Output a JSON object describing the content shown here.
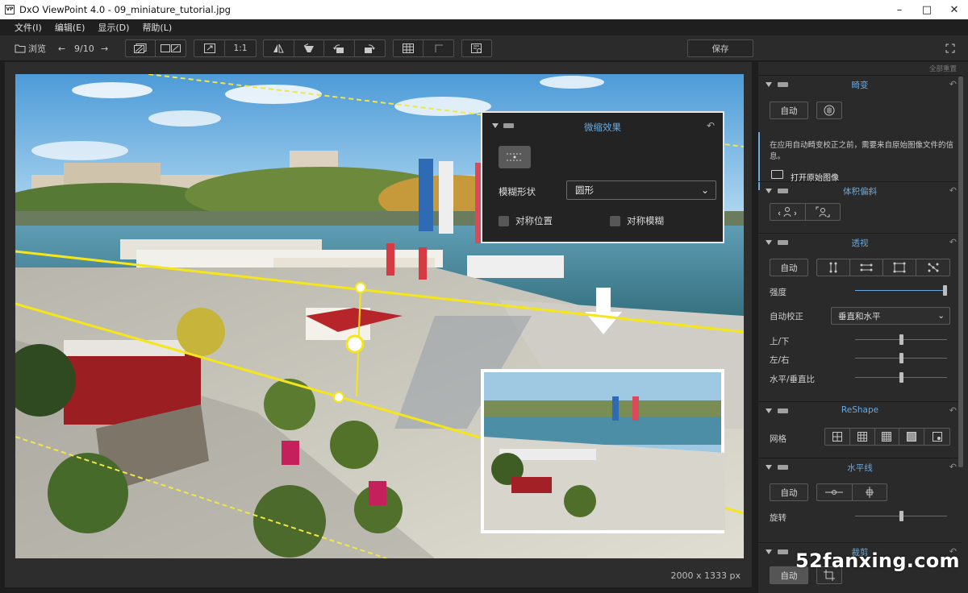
{
  "window": {
    "title": "DxO ViewPoint 4.0 - 09_miniature_tutorial.jpg",
    "app_icon_text": "VP"
  },
  "menu": [
    "文件(I)",
    "编辑(E)",
    "显示(D)",
    "帮助(L)"
  ],
  "toolbar": {
    "browse_label": "浏览",
    "page_counter": "9/10",
    "one_to_one": "1:1",
    "save_label": "保存"
  },
  "viewer": {
    "image_dimensions": "2000 x 1333 px"
  },
  "miniature_panel": {
    "title": "微缩效果",
    "blur_shape_label": "模糊形状",
    "blur_shape_value": "圆形",
    "sym_position_label": "对称位置",
    "sym_blur_label": "对称模糊"
  },
  "right_panel": {
    "reset_all": "全部重置",
    "distortion": {
      "title": "畸变",
      "auto_label": "自动",
      "note": "在应用自动畸变校正之前，需要来自原始图像文件的信息。",
      "open_original": "打开原始图像"
    },
    "volume": {
      "title": "体积偏斜"
    },
    "perspective": {
      "title": "透视",
      "auto_label": "自动",
      "intensity_label": "强度",
      "intensity_value": 1.0,
      "auto_correct_label": "自动校正",
      "auto_correct_value": "垂直和水平",
      "updown_label": "上/下",
      "updown_value": 0.5,
      "leftright_label": "左/右",
      "leftright_value": 0.5,
      "ratio_label": "水平/垂直比",
      "ratio_value": 0.5
    },
    "reshape": {
      "title": "ReShape",
      "grid_label": "网格"
    },
    "horizon": {
      "title": "水平线",
      "auto_label": "自动",
      "rotate_label": "旋转",
      "rotate_value": 0.5
    },
    "crop": {
      "title": "裁剪",
      "auto_label": "自动"
    }
  },
  "watermark": "52fanxing.com"
}
